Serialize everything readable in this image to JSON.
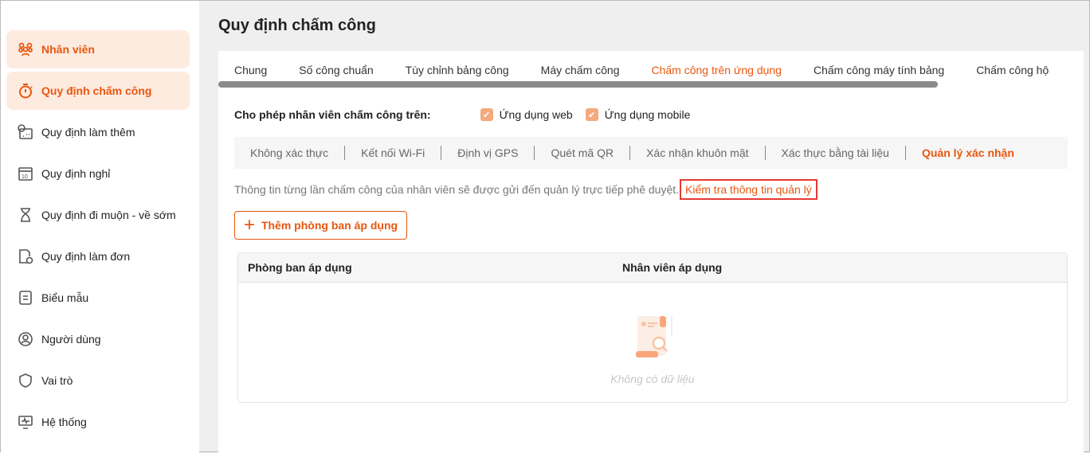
{
  "sidebar": {
    "items": [
      {
        "label": "Nhân viên",
        "icon": "users-icon",
        "active": true
      },
      {
        "label": "Quy định chấm công",
        "icon": "stopwatch-icon",
        "active": true
      },
      {
        "label": "Quy định làm thêm",
        "icon": "clock-calendar-icon"
      },
      {
        "label": "Quy định nghỉ",
        "icon": "calendar-10-icon"
      },
      {
        "label": "Quy định đi muộn - về sớm",
        "icon": "hourglass-icon"
      },
      {
        "label": "Quy định làm đơn",
        "icon": "document-clock-icon"
      },
      {
        "label": "Biểu mẫu",
        "icon": "form-icon"
      },
      {
        "label": "Người dùng",
        "icon": "user-circle-icon"
      },
      {
        "label": "Vai trò",
        "icon": "shield-icon"
      },
      {
        "label": "Hệ thống",
        "icon": "monitor-icon"
      }
    ]
  },
  "page": {
    "title": "Quy định chấm công"
  },
  "tabs": [
    "Chung",
    "Số công chuẩn",
    "Tùy chỉnh bảng công",
    "Máy chấm công",
    "Chấm công trên ứng dụng",
    "Chấm công máy tính bảng",
    "Chấm công hộ"
  ],
  "allow": {
    "label": "Cho phép nhân viên chấm công trên:",
    "options": [
      "Ứng dụng web",
      "Ứng dụng mobile"
    ]
  },
  "subtabs": [
    "Không xác thực",
    "Kết nối Wi-Fi",
    "Định vị GPS",
    "Quét mã QR",
    "Xác nhận khuôn mặt",
    "Xác thực bằng tài liệu",
    "Quản lý xác nhận"
  ],
  "info": {
    "text": "Thông tin từng lần chấm công của nhân viên sẽ được gửi đến quản lý trực tiếp phê duyệt.",
    "link": "Kiểm tra thông tin quản lý"
  },
  "add_button": "Thêm phòng ban áp dụng",
  "table": {
    "columns": [
      "Phòng ban áp dụng",
      "Nhân viên áp dụng"
    ],
    "empty": "Không có dữ liệu"
  },
  "colors": {
    "accent": "#e8570e"
  }
}
